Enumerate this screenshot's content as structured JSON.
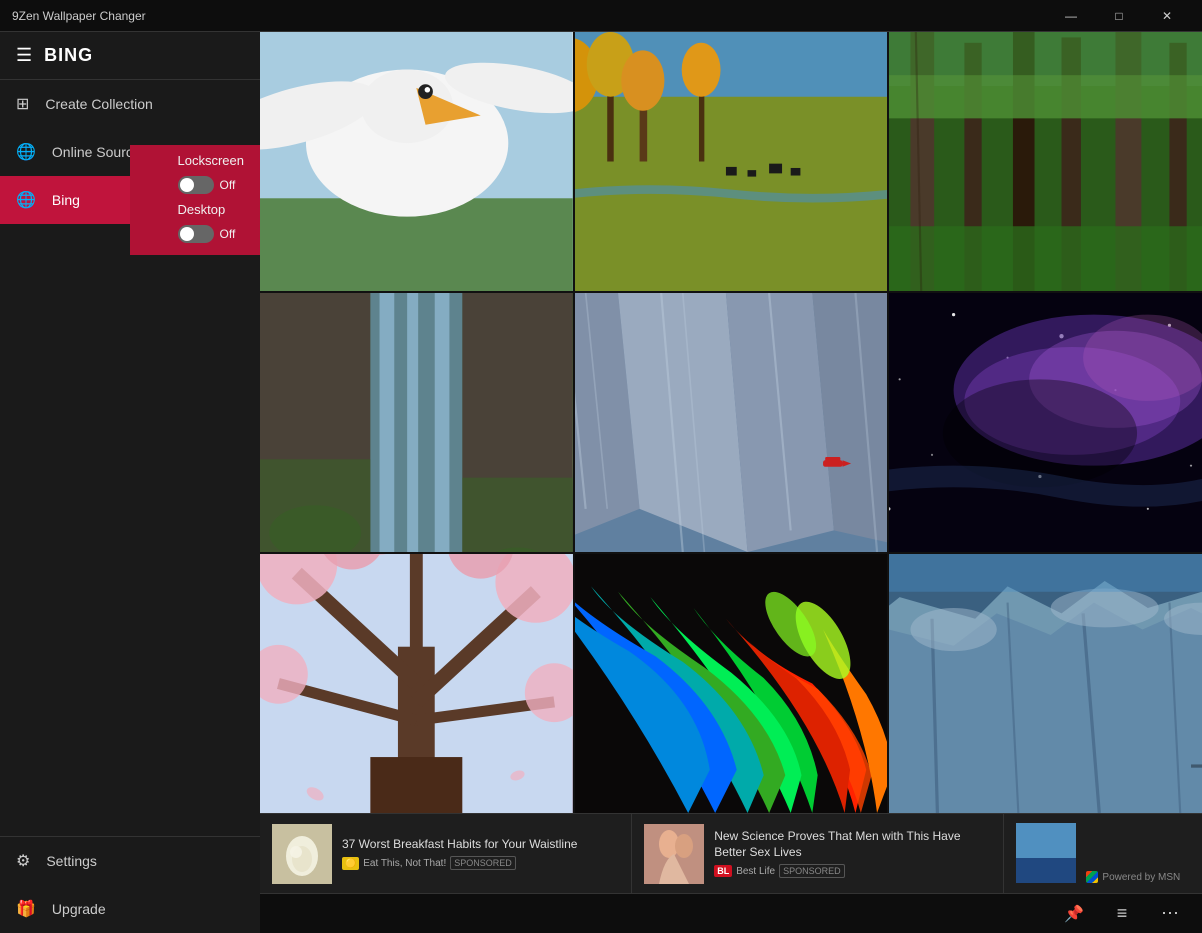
{
  "titlebar": {
    "title": "9Zen Wallpaper Changer",
    "minimize_label": "—",
    "maximize_label": "□",
    "close_label": "✕"
  },
  "sidebar": {
    "hamburger": "☰",
    "app_title": "BING",
    "nav_items": [
      {
        "id": "create-collection",
        "label": "Create Collection",
        "icon": "⊞"
      },
      {
        "id": "online-sources",
        "label": "Online Sources",
        "icon": "🌐"
      }
    ],
    "active_source": {
      "label": "Bing",
      "icon": "🌐",
      "lockscreen_label": "Lockscreen",
      "lockscreen_state": "Off",
      "desktop_label": "Desktop",
      "desktop_state": "Off"
    },
    "bottom_items": [
      {
        "id": "settings",
        "label": "Settings",
        "icon": "⚙"
      },
      {
        "id": "upgrade",
        "label": "Upgrade",
        "icon": "🎁"
      }
    ]
  },
  "toolbar": {
    "pin_icon": "📌",
    "list_icon": "≡",
    "more_icon": "⋯"
  },
  "ads": [
    {
      "title": "37 Worst Breakfast Habits for Your Waistline",
      "source": "Eat This, Not That!",
      "sponsored": "SPONSORED",
      "thumb": "egg"
    },
    {
      "title": "New Science Proves That Men with This Have Better Sex Lives",
      "source": "Best Life",
      "sponsored": "SPONSORED",
      "thumb": "couple"
    }
  ],
  "msn_label": "Powered by MSN",
  "images": [
    {
      "id": "pelican",
      "style": "pelican"
    },
    {
      "id": "steppe",
      "style": "steppe"
    },
    {
      "id": "forest",
      "style": "forest"
    },
    {
      "id": "waterfall",
      "style": "waterfall"
    },
    {
      "id": "glacier-canyon",
      "style": "glacier-canyon"
    },
    {
      "id": "nebula",
      "style": "nebula"
    },
    {
      "id": "cherry",
      "style": "cherry"
    },
    {
      "id": "feathers",
      "style": "feathers"
    },
    {
      "id": "iceberg",
      "style": "iceberg"
    }
  ]
}
